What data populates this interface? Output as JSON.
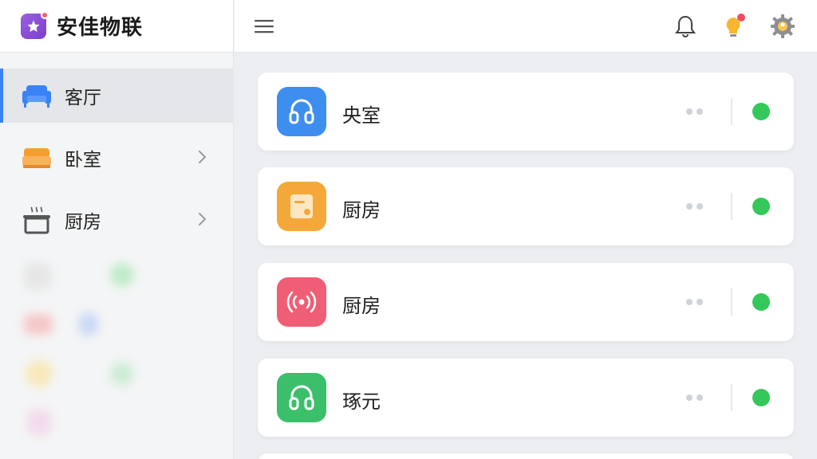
{
  "app": {
    "title": "安佳物联",
    "logo_color": "#8a4fd9",
    "accent": "#3b82f6"
  },
  "sidebar": {
    "items": [
      {
        "label": "客厅",
        "icon": "sofa-icon",
        "color": "#3b82f6",
        "active": true
      },
      {
        "label": "卧室",
        "icon": "bed-icon",
        "color": "#f59e32",
        "active": false
      },
      {
        "label": "厨房",
        "icon": "cooking-pot-icon",
        "color": "#555555",
        "active": false
      }
    ]
  },
  "topbar": {
    "icons": [
      "menu-icon",
      "bell-icon",
      "lightbulb-icon",
      "gear-icon"
    ]
  },
  "cards": [
    {
      "title": "央室",
      "icon": "headphones-icon",
      "color": "#3e8ef0",
      "status_color": "#34c759"
    },
    {
      "title": "厨房",
      "icon": "cabinet-icon",
      "color": "#f4a83a",
      "status_color": "#34c759"
    },
    {
      "title": "厨房",
      "icon": "broadcast-icon",
      "color": "#ef5e74",
      "status_color": "#34c759"
    },
    {
      "title": "琢元",
      "icon": "headphones-icon",
      "color": "#3cbf6b",
      "status_color": "#34c759"
    }
  ]
}
